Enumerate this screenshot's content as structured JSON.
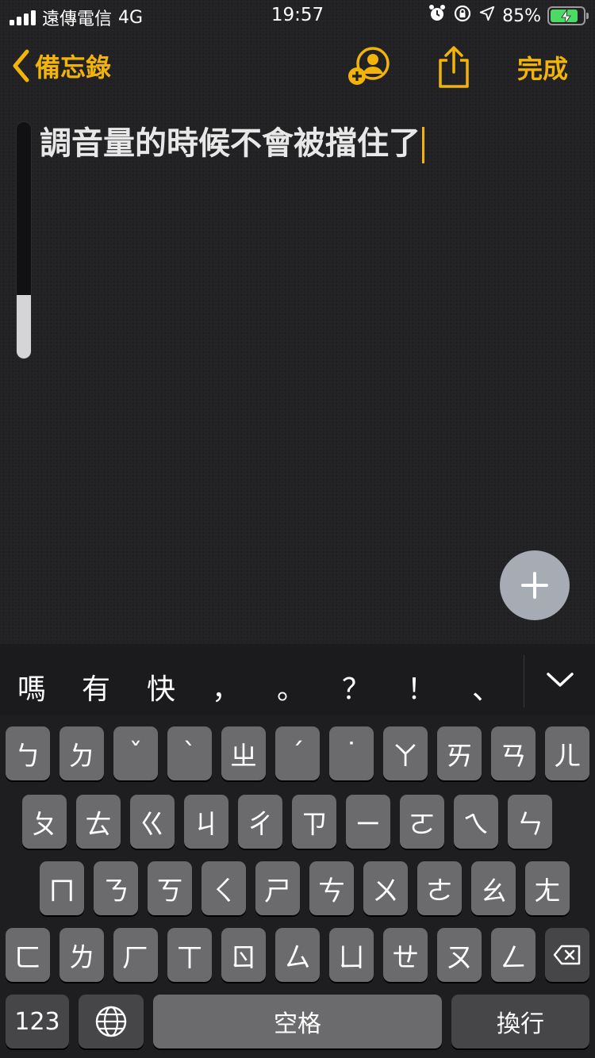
{
  "status_bar": {
    "carrier": "遠傳電信",
    "network": "4G",
    "time": "19:57",
    "battery_percent": "85%",
    "battery_level": 0.85,
    "icons": [
      "signal-icon",
      "alarm-icon",
      "rotation-lock-icon",
      "location-icon",
      "battery-charging-icon"
    ]
  },
  "nav": {
    "back_label": "備忘錄",
    "done_label": "完成",
    "icons": [
      "chevron-left-icon",
      "add-person-icon",
      "share-icon"
    ]
  },
  "note": {
    "text": "調音量的時候不會被擋住了"
  },
  "volume_hud": {
    "level": 0.27
  },
  "candidates": {
    "items": [
      "嗎",
      "有",
      "快",
      "，",
      "。",
      "？",
      "！",
      "、"
    ]
  },
  "keyboard": {
    "row1": [
      "ㄅ",
      "ㄉ",
      "ˇ",
      "ˋ",
      "ㄓ",
      "ˊ",
      "˙",
      "ㄚ",
      "ㄞ",
      "ㄢ",
      "ㄦ"
    ],
    "row2": [
      "ㄆ",
      "ㄊ",
      "ㄍ",
      "ㄐ",
      "ㄔ",
      "ㄗ",
      "ㄧ",
      "ㄛ",
      "ㄟ",
      "ㄣ"
    ],
    "row3": [
      "ㄇ",
      "ㄋ",
      "ㄎ",
      "ㄑ",
      "ㄕ",
      "ㄘ",
      "ㄨ",
      "ㄜ",
      "ㄠ",
      "ㄤ"
    ],
    "row4": [
      "ㄈ",
      "ㄌ",
      "ㄏ",
      "ㄒ",
      "ㄖ",
      "ㄙ",
      "ㄩ",
      "ㄝ",
      "ㄡ",
      "ㄥ"
    ],
    "numbers_label": "123",
    "space_label": "空格",
    "return_label": "換行",
    "accent_color": "#f2b40a"
  }
}
